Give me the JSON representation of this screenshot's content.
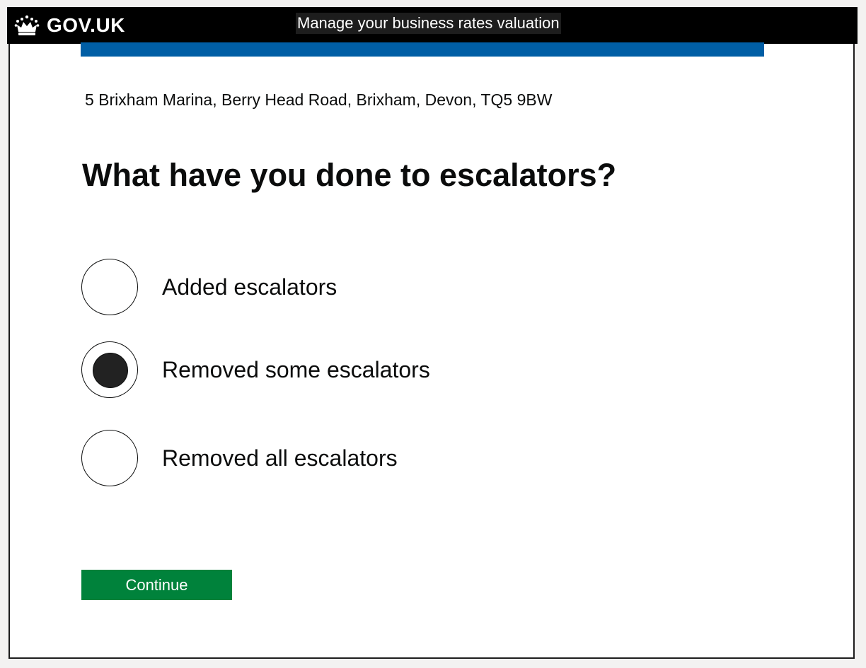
{
  "header": {
    "logo_text": "GOV.UK",
    "logo_icon": "crown-icon",
    "service_name": "Manage your business rates valuation"
  },
  "colors": {
    "header_background": "#000000",
    "accent_bar": "#005ea5",
    "button_primary": "#00823b",
    "text": "#0b0c0c"
  },
  "property": {
    "address": "5 Brixham Marina, Berry Head Road, Brixham, Devon, TQ5 9BW"
  },
  "question": {
    "title": "What have you done to escalators?"
  },
  "options": [
    {
      "label": "Added escalators",
      "selected": false
    },
    {
      "label": "Removed some escalators",
      "selected": true
    },
    {
      "label": "Removed all escalators",
      "selected": false
    }
  ],
  "actions": {
    "continue_label": "Continue"
  }
}
